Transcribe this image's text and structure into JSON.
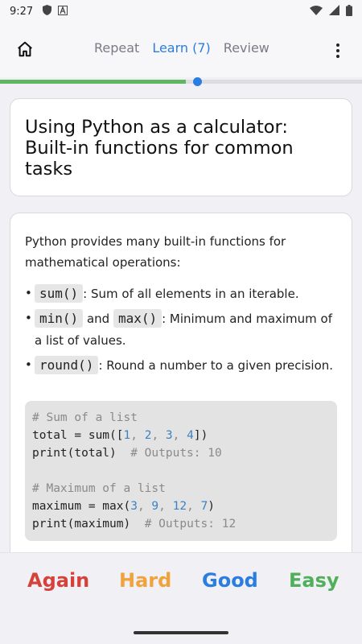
{
  "status_bar": {
    "time": "9:27"
  },
  "nav": {
    "tabs": [
      {
        "label": "Repeat",
        "active": false
      },
      {
        "label": "Learn (7)",
        "active": true
      },
      {
        "label": "Review",
        "active": false
      }
    ]
  },
  "progress": {
    "fraction": 0.54
  },
  "card": {
    "title": "Using Python as a calculator: Built-in functions for common tasks",
    "intro": "Python provides many built-in functions for mathematical operations:",
    "bullets": [
      {
        "code1": "sum()",
        "text1": ": Sum of all elements in an iterable."
      },
      {
        "code1": "min()",
        "mid": " and ",
        "code2": "max()",
        "text2": ": Minimum and maximum of a list of values."
      },
      {
        "code1": "round()",
        "text1": ": Round a number to a given precision."
      }
    ],
    "code": {
      "line1": "# Sum of a list",
      "line2_a": "total = sum([",
      "line2_n1": "1",
      "line2_n2": "2",
      "line2_n3": "3",
      "line2_n4": "4",
      "line2_b": "])",
      "line3_a": "print(total)  ",
      "line3_c": "# Outputs: 10",
      "line5": "# Maximum of a list",
      "line6_a": "maximum = max(",
      "line6_n1": "3",
      "line6_n2": "9",
      "line6_n3": "12",
      "line6_n4": "7",
      "line6_b": ")",
      "line7_a": "print(maximum)  ",
      "line7_c": "# Outputs: 12"
    }
  },
  "answers": {
    "again": "Again",
    "hard": "Hard",
    "good": "Good",
    "easy": "Easy"
  },
  "colors": {
    "accent": "#2a7de1",
    "progress": "#5fb760",
    "again": "#d6423b",
    "hard": "#f0a33c",
    "good": "#2a7de1",
    "easy": "#4faf5b"
  },
  "icons": {
    "home": "home-icon",
    "menu": "more-vert-icon",
    "status": [
      "shield-icon",
      "a-letter-icon",
      "wifi-icon",
      "signal-icon",
      "battery-icon"
    ]
  }
}
